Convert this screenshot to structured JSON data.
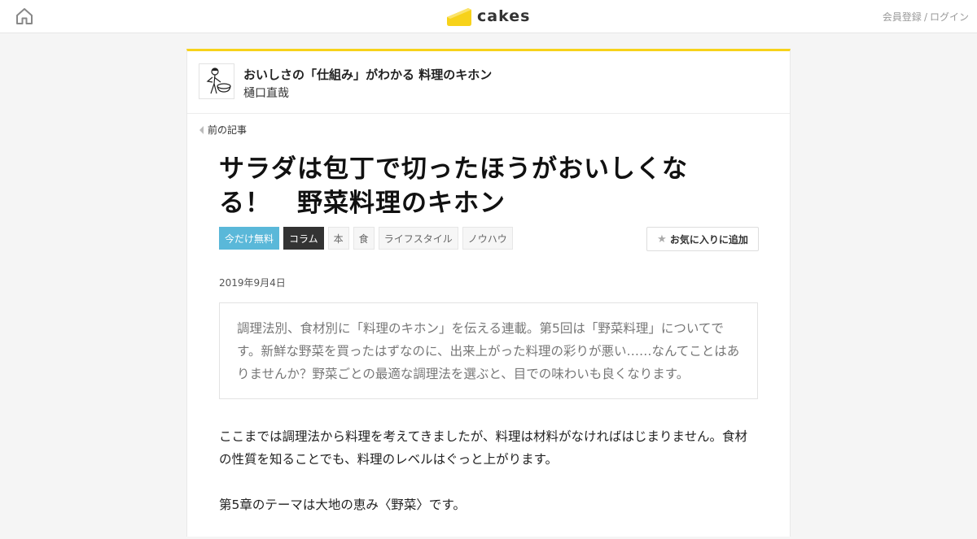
{
  "header": {
    "logo_text": "cakes",
    "brand_color": "#f7d21a",
    "register_label": "会員登録",
    "separator": "/",
    "login_label": "ログイン"
  },
  "series": {
    "title": "おいしさの「仕組み」がわかる 料理のキホン",
    "author": "樋口直哉"
  },
  "nav": {
    "prev_label": "前の記事"
  },
  "article": {
    "title": "サラダは包丁で切ったほうがおいしくなる！　野菜料理のキホン",
    "tags": [
      {
        "label": "今だけ無料",
        "kind": "free"
      },
      {
        "label": "コラム",
        "kind": "column"
      },
      {
        "label": "本",
        "kind": "normal"
      },
      {
        "label": "食",
        "kind": "normal"
      },
      {
        "label": "ライフスタイル",
        "kind": "normal"
      },
      {
        "label": "ノウハウ",
        "kind": "normal"
      }
    ],
    "favorite_label": "お気に入りに追加",
    "date": "2019年9月4日",
    "lead": "調理法別、食材別に「料理のキホン」を伝える連載。第5回は「野菜料理」についてです。新鮮な野菜を買ったはずなのに、出来上がった料理の彩りが悪い……なんてことはありませんか？野菜ごとの最適な調理法を選ぶと、目での味わいも良くなります。",
    "paragraphs": [
      "ここまでは調理法から料理を考えてきましたが、料理は材料がなければはじまりません。食材の性質を知ることでも、料理のレベルはぐっと上がります。",
      "第5章のテーマは大地の恵み〈野菜〉です。"
    ]
  },
  "colors": {
    "free_tag": "#5ab8d9",
    "column_tag": "#333333",
    "accent": "#f7d21a"
  }
}
